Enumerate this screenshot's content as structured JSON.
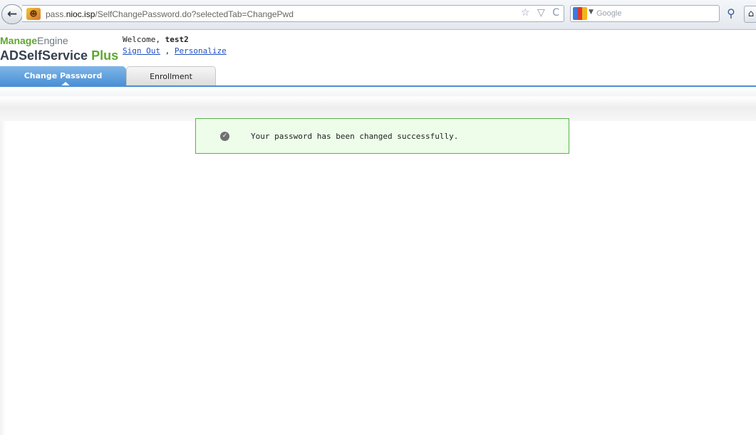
{
  "browser": {
    "url_prefix": "pass.",
    "url_host": "nioc.isp",
    "url_path": "/SelfChangePassword.do?selectedTab=ChangePwd",
    "search_placeholder": "Google",
    "back_glyph": "←",
    "refresh_glyph": "C",
    "star_glyph": "☆",
    "dropdown_glyph": "▽"
  },
  "app": {
    "logo_line1_a": "Manage",
    "logo_line1_b": "Engine",
    "logo_line2_a": "ADSelfService ",
    "logo_line2_b": "Plus",
    "welcome_prefix": "Welcome, ",
    "username": "test2",
    "sign_out": "Sign Out",
    "link_separator": " , ",
    "personalize": "Personalize"
  },
  "tabs": [
    {
      "label": "Change Password",
      "active": true
    },
    {
      "label": "Enrollment",
      "active": false
    }
  ],
  "message": {
    "text": "Your password has been changed successfully.",
    "icon": "check-circle-icon",
    "status_color": "#58b34a"
  }
}
